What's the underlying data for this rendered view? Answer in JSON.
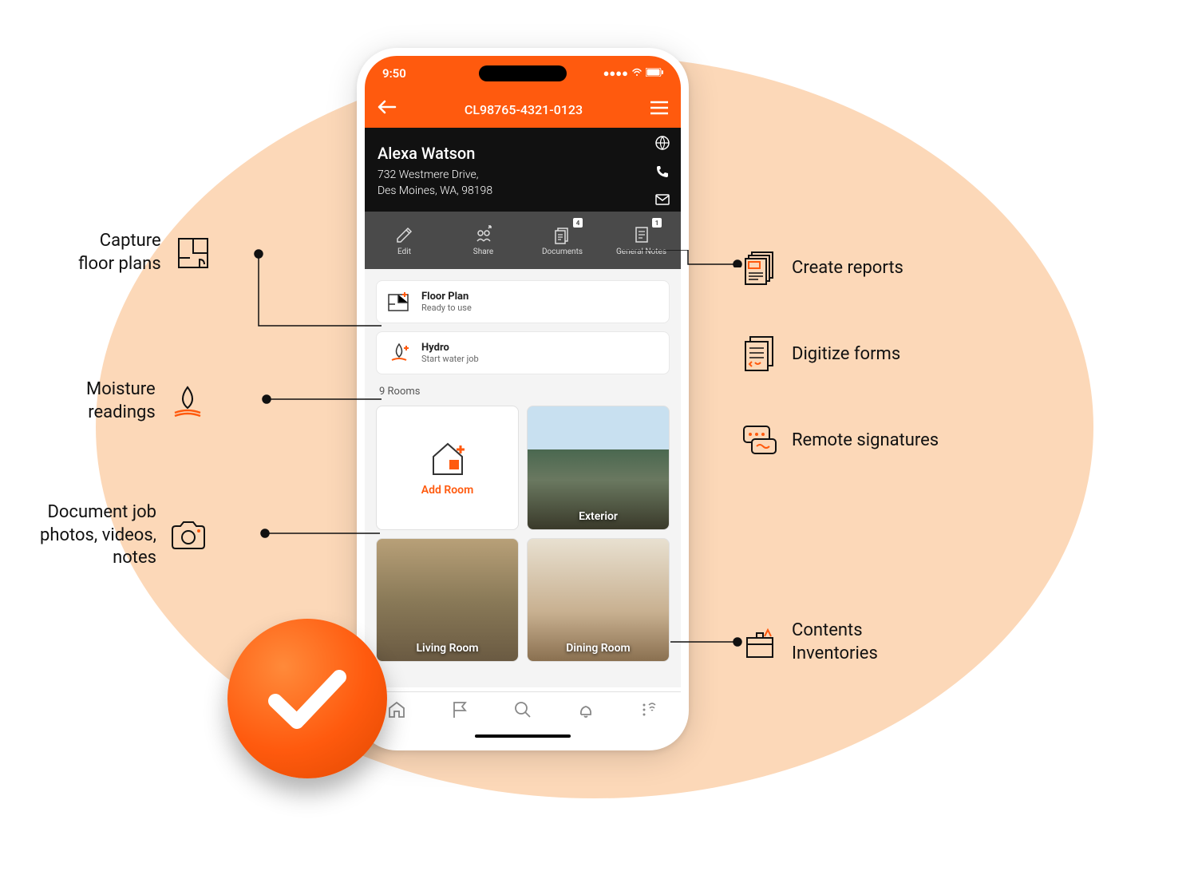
{
  "status_bar": {
    "time": "9:50"
  },
  "nav": {
    "claim_id": "CL98765-4321-0123"
  },
  "client": {
    "name": "Alexa Watson",
    "address_line1": "732 Westmere Drive,",
    "address_line2": "Des Moines, WA, 98198"
  },
  "actions": {
    "edit": "Edit",
    "share": "Share",
    "documents": "Documents",
    "documents_badge": "4",
    "general_notes": "General Notes",
    "notes_badge": "1"
  },
  "cards": {
    "floor_plan": {
      "title": "Floor Plan",
      "sub": "Ready to use"
    },
    "hydro": {
      "title": "Hydro",
      "sub": "Start water job"
    }
  },
  "rooms": {
    "section_label": "9 Rooms",
    "add_label": "Add Room",
    "tiles": [
      {
        "label": "Exterior"
      },
      {
        "label": "Living Room"
      },
      {
        "label": "Dining Room"
      }
    ]
  },
  "callouts": {
    "left": [
      {
        "text": "Capture\nfloor plans"
      },
      {
        "text": "Moisture\nreadings"
      },
      {
        "text": "Document job\nphotos, videos,\nnotes"
      }
    ],
    "right": [
      {
        "text": "Create reports"
      },
      {
        "text": "Digitize forms"
      },
      {
        "text": "Remote signatures"
      },
      {
        "text": "Contents\nInventories"
      }
    ]
  }
}
